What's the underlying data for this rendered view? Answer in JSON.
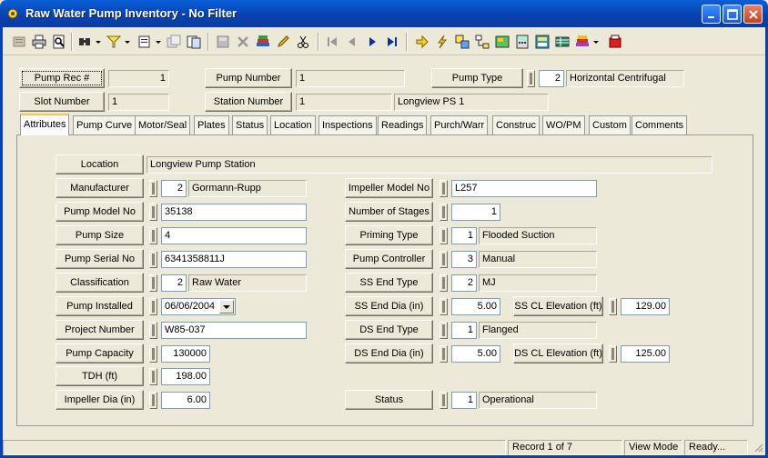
{
  "window": {
    "title": "Raw Water Pump Inventory - No Filter"
  },
  "header": {
    "pump_rec_label": "Pump Rec #",
    "pump_rec_value": "1",
    "pump_number_label": "Pump Number",
    "pump_number_value": "1",
    "pump_type_label": "Pump Type",
    "pump_type_code": "2",
    "pump_type_value": "Horizontal Centrifugal",
    "slot_number_label": "Slot Number",
    "slot_number_value": "1",
    "station_number_label": "Station Number",
    "station_number_value": "1",
    "station_name": "Longview PS 1"
  },
  "tabs": [
    {
      "label": "Attributes",
      "active": true
    },
    {
      "label": "Pump Curve"
    },
    {
      "label": "Motor/Seal"
    },
    {
      "label": "Plates"
    },
    {
      "label": "Status"
    },
    {
      "label": "Location"
    },
    {
      "label": "Inspections"
    },
    {
      "label": "Readings"
    },
    {
      "label": "Purch/Warr"
    },
    {
      "label": "Construc"
    },
    {
      "label": "WO/PM"
    },
    {
      "label": "Custom"
    },
    {
      "label": "Comments"
    }
  ],
  "attributes": {
    "location_label": "Location",
    "location_value": "Longview Pump Station",
    "manufacturer_label": "Manufacturer",
    "manufacturer_code": "2",
    "manufacturer_value": "Gormann-Rupp",
    "pump_model_label": "Pump Model No",
    "pump_model_value": "35138",
    "pump_size_label": "Pump Size",
    "pump_size_value": "4",
    "pump_serial_label": "Pump Serial No",
    "pump_serial_value": "6341358811J",
    "classification_label": "Classification",
    "classification_code": "2",
    "classification_value": "Raw Water",
    "pump_installed_label": "Pump Installed",
    "pump_installed_value": "06/06/2004",
    "project_number_label": "Project Number",
    "project_number_value": "W85-037",
    "pump_capacity_label": "Pump Capacity",
    "pump_capacity_value": "130000",
    "tdh_label": "TDH (ft)",
    "tdh_value": "198.00",
    "impeller_dia_label": "Impeller Dia (in)",
    "impeller_dia_value": "6.00",
    "impeller_model_label": "Impeller Model No",
    "impeller_model_value": "L257",
    "stages_label": "Number of Stages",
    "stages_value": "1",
    "priming_label": "Priming Type",
    "priming_code": "1",
    "priming_value": "Flooded Suction",
    "controller_label": "Pump Controller",
    "controller_code": "3",
    "controller_value": "Manual",
    "ss_end_type_label": "SS End Type",
    "ss_end_type_code": "2",
    "ss_end_type_value": "MJ",
    "ss_end_dia_label": "SS End Dia (in)",
    "ss_end_dia_value": "5.00",
    "ss_cl_elev_label": "SS CL Elevation (ft)",
    "ss_cl_elev_value": "129.00",
    "ds_end_type_label": "DS End Type",
    "ds_end_type_code": "1",
    "ds_end_type_value": "Flanged",
    "ds_end_dia_label": "DS End Dia (in)",
    "ds_end_dia_value": "5.00",
    "ds_cl_elev_label": "DS CL Elevation (ft)",
    "ds_cl_elev_value": "125.00",
    "status_label": "Status",
    "status_code": "1",
    "status_value": "Operational"
  },
  "statusbar": {
    "record": "Record 1 of 7",
    "mode": "View Mode",
    "state": "Ready..."
  },
  "toolbar_icons": [
    "new-icon",
    "print-icon",
    "print-preview-icon",
    "find-icon",
    "filter-icon",
    "view-icon",
    "copy-record-icon",
    "clone-icon",
    "save-icon",
    "delete-icon",
    "books-icon",
    "edit-pencil-icon",
    "cut-icon",
    "first-record-icon",
    "prev-record-icon",
    "next-record-icon",
    "last-record-icon",
    "goto-icon",
    "lightning-icon",
    "linked-records-icon",
    "hierarchy-icon",
    "map-icon",
    "calculator-icon",
    "report-icon",
    "table-icon",
    "library-icon",
    "exit-icon"
  ],
  "colors": {
    "title_bar": "#0842b0",
    "panel": "#ece9d8",
    "tab_highlight": "#ffc83c"
  }
}
